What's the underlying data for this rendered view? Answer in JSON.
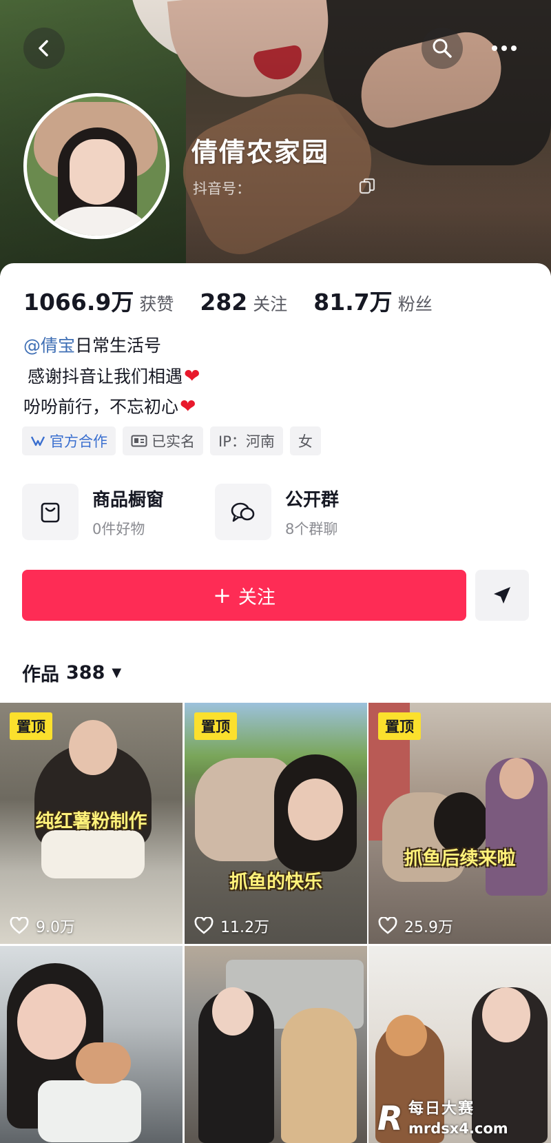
{
  "header": {
    "nickname": "倩倩农家园",
    "douyin_id_label": "抖音号："
  },
  "stats": [
    {
      "value": "1066.9万",
      "label": "获赞"
    },
    {
      "value": "282",
      "label": "关注"
    },
    {
      "value": "81.7万",
      "label": "粉丝"
    }
  ],
  "bio": {
    "mention": "@倩宝",
    "line1_rest": "日常生活号",
    "line2": "感谢抖音让我们相遇",
    "line3": "吩吩前行，不忘初心",
    "heart": "❤"
  },
  "tags": [
    {
      "label": "官方合作",
      "icon": "official-partner-icon"
    },
    {
      "label": "已实名",
      "icon": "id-card-icon"
    },
    {
      "label": "IP：河南"
    },
    {
      "label": "女"
    }
  ],
  "shortcuts": {
    "shop": {
      "title": "商品橱窗",
      "subtitle": "0件好物",
      "icon": "shopping-bag-icon"
    },
    "group": {
      "title": "公开群",
      "subtitle": "8个群聊",
      "icon": "group-chat-icon"
    }
  },
  "actions": {
    "follow_label": "关注",
    "follow_plus": "+"
  },
  "works": {
    "label": "作品",
    "count": "388",
    "dropdown_icon": "▼"
  },
  "videos": [
    {
      "pinned": "置顶",
      "caption": "纯红薯粉制作",
      "likes": "9.0万"
    },
    {
      "pinned": "置顶",
      "caption": "抓鱼的快乐",
      "likes": "11.2万"
    },
    {
      "pinned": "置顶",
      "caption": "抓鱼后续来啦",
      "likes": "25.9万"
    },
    {
      "caption": "",
      "likes": ""
    },
    {
      "caption": "",
      "likes": ""
    },
    {
      "caption": "",
      "likes": ""
    }
  ],
  "watermark": {
    "logo": "R",
    "name": "每日大赛",
    "url": "mrdsx4.com"
  },
  "colors": {
    "accent": "#fe2c55",
    "pin": "#fbe02d",
    "mention": "#3f6fb5"
  }
}
